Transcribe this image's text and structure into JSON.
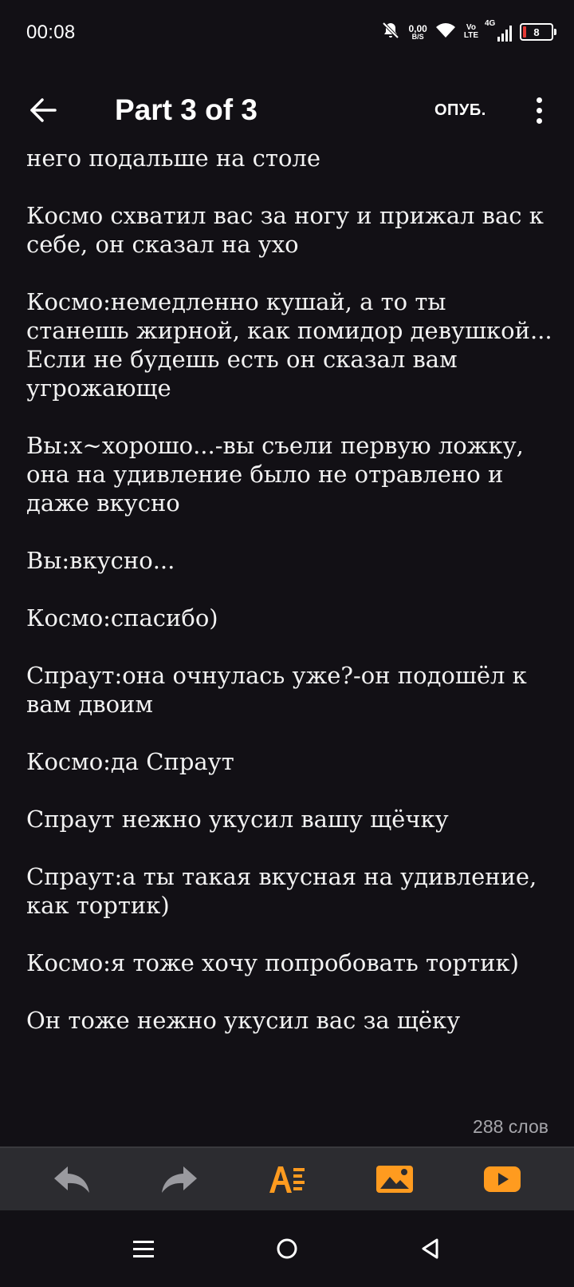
{
  "status_bar": {
    "time": "00:08",
    "net_speed_value": "0,00",
    "net_speed_unit": "B/S",
    "volte_top": "Vo",
    "volte_bottom": "LTE",
    "network": "4G",
    "battery": "8",
    "icons": [
      "bell-muted-icon",
      "wifi-icon",
      "signal-icon",
      "battery-icon"
    ]
  },
  "toolbar": {
    "title": "Part 3 of 3",
    "publish_label": "ОПУБ.",
    "icons": [
      "back-arrow-icon",
      "more-vertical-icon"
    ]
  },
  "story": {
    "paragraphs": [
      "Вы:нет......вы попытались отодвинулся от него подальше на столе",
      "Космо схватил вас за ногу и прижал вас к себе, он сказал на ухо",
      "Космо:немедленно кушай, а то ты станешь жирной, как помидор девушкой... Если не будешь есть он сказал вам угрожающе",
      "Вы:х~хорошо...-вы съели первую ложку, она на удивление было не отравлено и даже вкусно",
      "Вы:вкусно...",
      "Космо:спасибо)",
      "Спраут:она очнулась уже?-он подошёл к вам двоим",
      "Космо:да Спраут",
      "Спраут нежно укусил вашу щёчку",
      "Спраут:а ты такая вкусная на удивление, как тортик)",
      "Космо:я тоже хочу попробовать тортик)",
      "Он тоже нежно укусил вас за щёку"
    ],
    "word_count": "288 слов"
  },
  "editor_bar": {
    "buttons": [
      "undo-icon",
      "redo-icon",
      "text-format-icon",
      "insert-image-icon",
      "insert-video-icon"
    ],
    "accent_color": "#ff9b1f",
    "muted_color": "#9a9a9f"
  },
  "system_nav": {
    "icons": [
      "recents-icon",
      "home-icon",
      "back-icon"
    ]
  }
}
